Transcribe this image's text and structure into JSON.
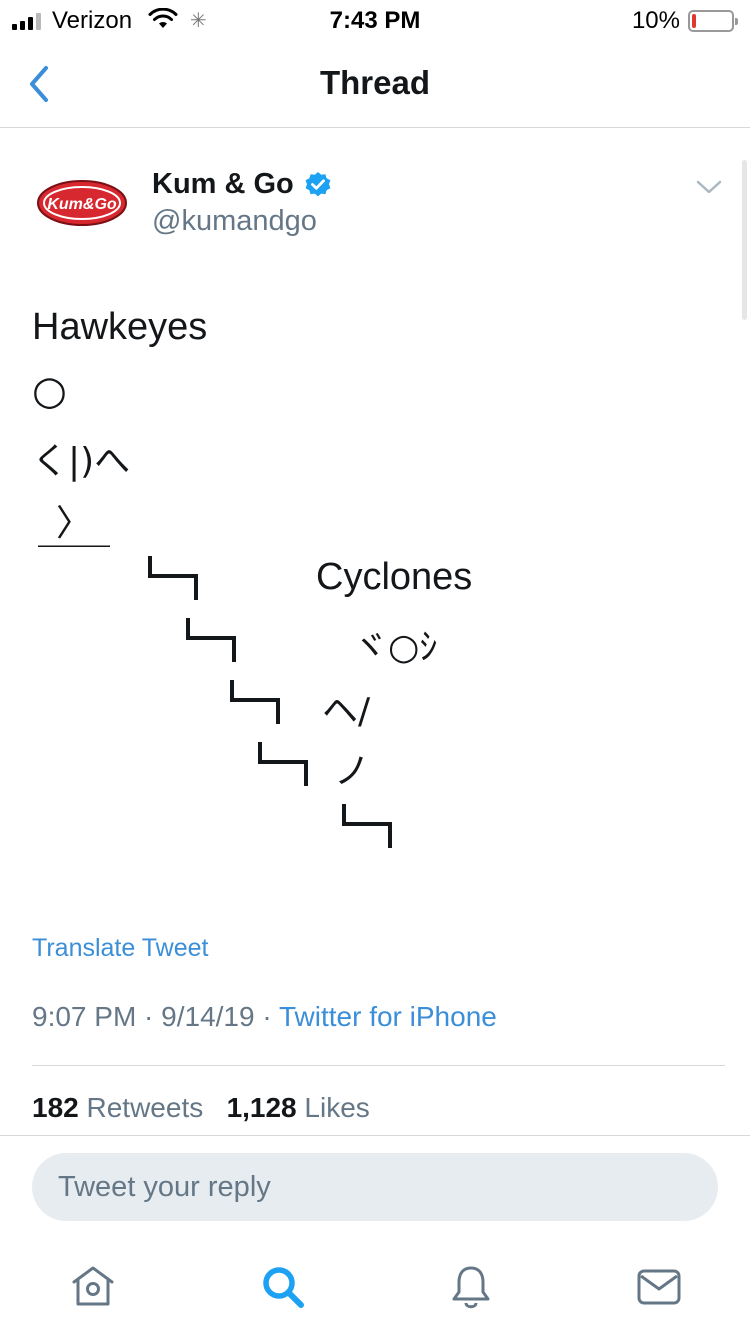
{
  "status_bar": {
    "carrier": "Verizon",
    "time": "7:43 PM",
    "battery_percent": "10%",
    "battery_level": 0.1
  },
  "nav": {
    "title": "Thread",
    "back_icon": "chevron-left-icon"
  },
  "tweet": {
    "avatar_text": "Kum&Go",
    "display_name": "Kum & Go",
    "verified": true,
    "handle": "@kumandgo",
    "lines": {
      "hawkeyes": "Hawkeyes",
      "head": "○",
      "body": "く|)へ",
      "leg": "〉",
      "ground": "￣￣",
      "cyclones": "Cyclones",
      "cyc_head": "ヾ○ｼ",
      "cyc_body": "ヘ/",
      "cyc_leg": "ノ"
    },
    "translate_label": "Translate Tweet",
    "timestamp": "9:07 PM · 9/14/19 · ",
    "source": "Twitter for iPhone",
    "retweets_count": "182",
    "retweets_label": "Retweets",
    "likes_count": "1,128",
    "likes_label": "Likes"
  },
  "reply": {
    "placeholder": "Tweet your reply"
  },
  "tab_bar": {
    "items": [
      "home-icon",
      "search-icon",
      "notifications-icon",
      "messages-icon"
    ],
    "active": "search-icon"
  },
  "colors": {
    "accent": "#1da1f2",
    "link": "#3b8ed8",
    "secondary_text": "#657786",
    "battery_low": "#e0382e",
    "avatar_red": "#d7282f"
  }
}
